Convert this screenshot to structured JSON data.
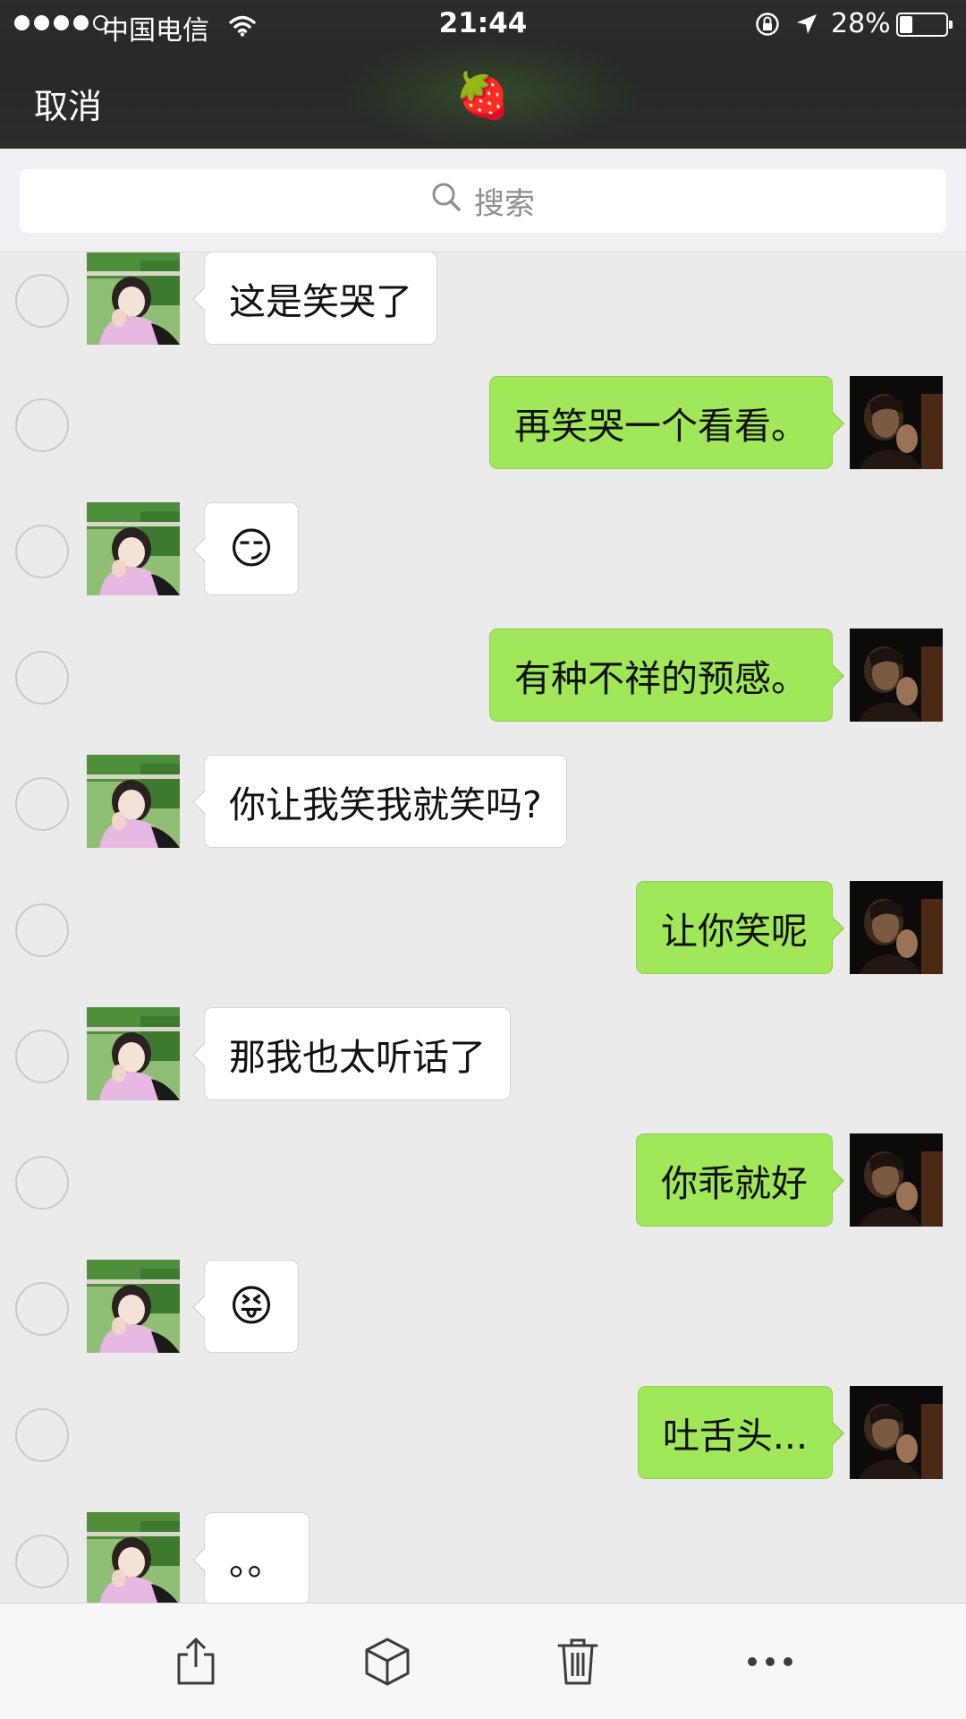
{
  "status_bar": {
    "carrier": "中国电信",
    "time": "21:44",
    "battery_percent": "28%",
    "battery_level": 0.28,
    "signal_bars": 4,
    "signal_total": 5
  },
  "nav": {
    "cancel_label": "取消",
    "title_emoji": "🍓"
  },
  "search": {
    "placeholder": "搜索"
  },
  "messages": [
    {
      "side": "left",
      "text": "这是笑哭了"
    },
    {
      "side": "right",
      "text": "再笑哭一个看看。"
    },
    {
      "side": "left",
      "text": "😏"
    },
    {
      "side": "right",
      "text": "有种不祥的预感。"
    },
    {
      "side": "left",
      "text": "你让我笑我就笑吗?"
    },
    {
      "side": "right",
      "text": "让你笑呢"
    },
    {
      "side": "left",
      "text": "那我也太听话了"
    },
    {
      "side": "right",
      "text": "你乖就好"
    },
    {
      "side": "left",
      "text": "😝"
    },
    {
      "side": "right",
      "text": "吐舌头..."
    },
    {
      "side": "left",
      "text": "。。"
    }
  ],
  "toolbar": {
    "icons": [
      "share-icon",
      "box-icon",
      "trash-icon",
      "more-icon"
    ]
  },
  "colors": {
    "sent_bubble": "#a0e759",
    "received_bubble": "#ffffff",
    "background": "#ebebeb",
    "nav_bar": "#2b2c2b"
  }
}
